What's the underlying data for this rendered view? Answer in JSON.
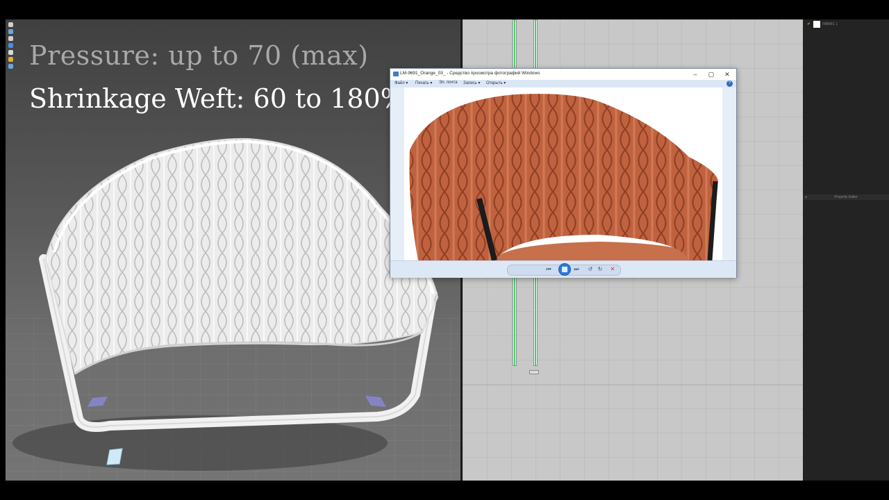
{
  "overlay": {
    "pressure_text": "Pressure: up to 70 (max)",
    "shrinkage_text": "Shrinkage Weft: 60 to 180%"
  },
  "object_browser": {
    "object_name": "FABRIC 1"
  },
  "property_editor": {
    "title": "Property Editor"
  },
  "photo_viewer": {
    "title": "LM-9691_Orange_03_ - Средство просмотра фотографий Windows",
    "menu": {
      "file": "Файл",
      "print": "Печать",
      "email": "Эл. почта",
      "burn": "Запись",
      "open": "Открыть"
    },
    "help": "?"
  },
  "colors": {
    "viewport_bg": "#5b5b5b",
    "pattern_bg": "#c8c8c8",
    "seam_green": "#3cd06a",
    "fabric_orange": "#c0623f",
    "panel_dark": "#232323"
  },
  "icons": {
    "minimize": "minimize-icon",
    "maximize": "maximize-icon",
    "close": "close-icon",
    "zoom": "zoom-icon",
    "fit": "fit-window-icon",
    "previous": "previous-icon",
    "slideshow": "slideshow-icon",
    "next": "next-icon",
    "rotate_left": "rotate-left-icon",
    "rotate_right": "rotate-right-icon",
    "delete": "delete-icon"
  }
}
